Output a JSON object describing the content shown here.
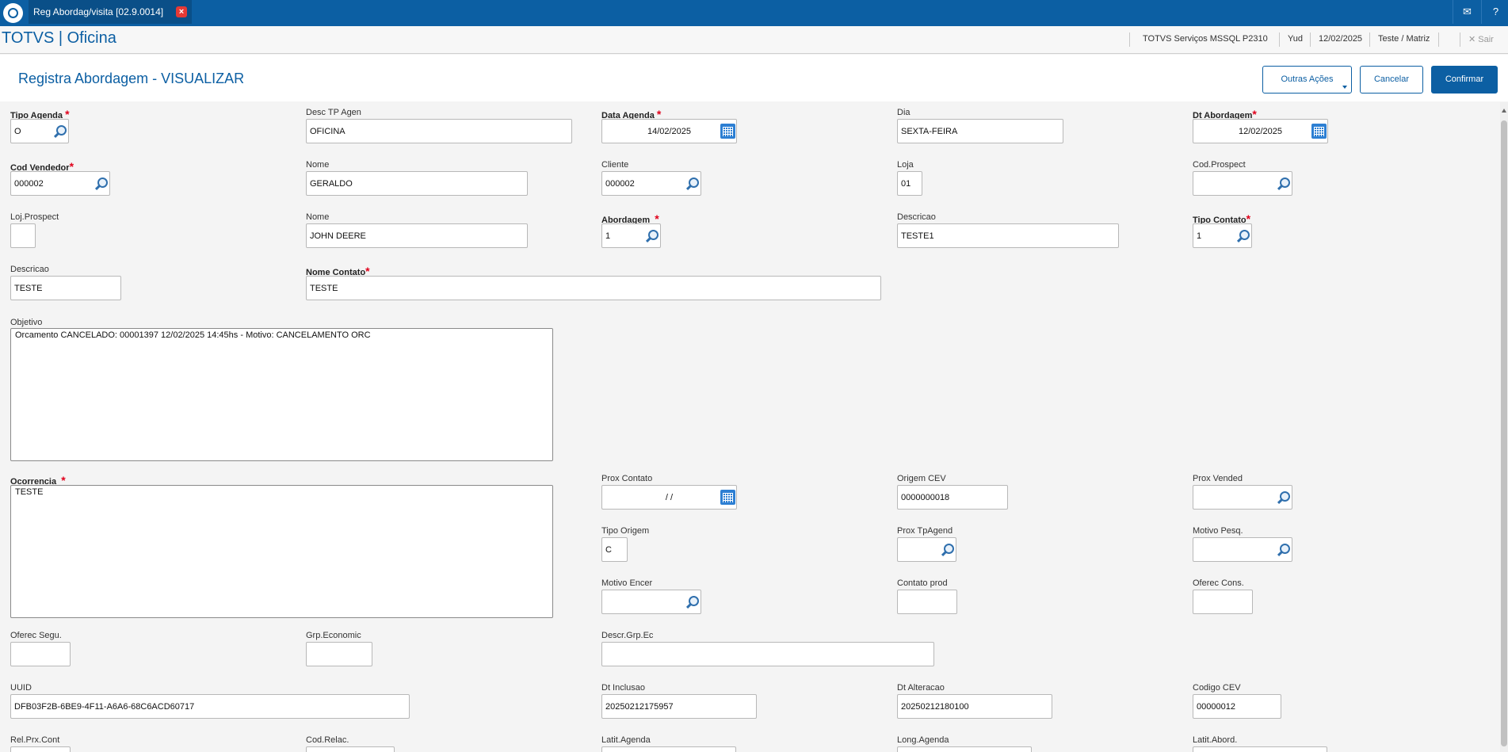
{
  "tab": {
    "title": "Reg Abordag/visita [02.9.0014]"
  },
  "header": {
    "brand": "TOTVS | Oficina",
    "environment": "TOTVS Serviços MSSQL P2310",
    "user": "Yud",
    "date": "12/02/2025",
    "company": "Teste / Matriz",
    "logout": "Sair"
  },
  "page": {
    "title": "Registra Abordagem - VISUALIZAR"
  },
  "actions": {
    "other": "Outras Ações",
    "cancel": "Cancelar",
    "confirm": "Confirmar"
  },
  "fields": {
    "tipo_agenda": {
      "label": "Tipo Agenda",
      "value": "O"
    },
    "desc_tp_agen": {
      "label": "Desc TP Agen",
      "value": "OFICINA"
    },
    "data_agenda": {
      "label": "Data Agenda",
      "value": "14/02/2025"
    },
    "dia": {
      "label": "Dia",
      "value": "SEXTA-FEIRA"
    },
    "dt_abordagem": {
      "label": "Dt Abordagem",
      "value": "12/02/2025"
    },
    "cod_vendedor": {
      "label": "Cod Vendedor",
      "value": "000002"
    },
    "nome_vendedor": {
      "label": "Nome",
      "value": "GERALDO"
    },
    "cliente": {
      "label": "Cliente",
      "value": "000002"
    },
    "loja": {
      "label": "Loja",
      "value": "01"
    },
    "cod_prospect": {
      "label": "Cod.Prospect",
      "value": ""
    },
    "loj_prospect": {
      "label": "Loj.Prospect",
      "value": ""
    },
    "nome_cliente": {
      "label": "Nome",
      "value": "JOHN DEERE"
    },
    "abordagem": {
      "label": "Abordagem",
      "value": "1"
    },
    "descricao_abordagem": {
      "label": "Descricao",
      "value": "TESTE1"
    },
    "tipo_contato": {
      "label": "Tipo Contato",
      "value": "1"
    },
    "descricao_contato": {
      "label": "Descricao",
      "value": "TESTE"
    },
    "nome_contato": {
      "label": "Nome Contato",
      "value": "TESTE"
    },
    "objetivo": {
      "label": "Objetivo",
      "value": "Orcamento CANCELADO: 00001397 12/02/2025 14:45hs - Motivo: CANCELAMENTO ORC"
    },
    "ocorrencia": {
      "label": "Ocorrencia",
      "value": "TESTE"
    },
    "prox_contato": {
      "label": "Prox Contato",
      "value": "/  /"
    },
    "origem_cev": {
      "label": "Origem CEV",
      "value": "0000000018"
    },
    "prox_vended": {
      "label": "Prox Vended",
      "value": ""
    },
    "tipo_origem": {
      "label": "Tipo Origem",
      "value": "C"
    },
    "prox_tpagend": {
      "label": "Prox TpAgend",
      "value": ""
    },
    "motivo_pesq": {
      "label": "Motivo Pesq.",
      "value": ""
    },
    "motivo_encer": {
      "label": "Motivo Encer",
      "value": ""
    },
    "contato_prod": {
      "label": "Contato prod",
      "value": ""
    },
    "oferec_cons": {
      "label": "Oferec Cons.",
      "value": ""
    },
    "oferec_segu": {
      "label": "Oferec Segu.",
      "value": ""
    },
    "grp_economic": {
      "label": "Grp.Economic",
      "value": ""
    },
    "descr_grp_ec": {
      "label": "Descr.Grp.Ec",
      "value": ""
    },
    "uuid": {
      "label": "UUID",
      "value": "DFB03F2B-6BE9-4F11-A6A6-68C6ACD60717"
    },
    "dt_inclusao": {
      "label": "Dt Inclusao",
      "value": "20250212175957"
    },
    "dt_alteracao": {
      "label": "Dt Alteracao",
      "value": "20250212180100"
    },
    "codigo_cev": {
      "label": "Codigo CEV",
      "value": "00000012"
    },
    "rel_prx_cont": {
      "label": "Rel.Prx.Cont",
      "value": ""
    },
    "cod_relac": {
      "label": "Cod.Relac.",
      "value": ""
    },
    "latit_agenda": {
      "label": "Latit.Agenda",
      "value": ""
    },
    "long_agenda": {
      "label": "Long.Agenda",
      "value": ""
    },
    "latit_abord": {
      "label": "Latit.Abord.",
      "value": ""
    }
  },
  "colors": {
    "primary": "#0c5fa3",
    "required": "#e0001b",
    "background": "#f4f4f4"
  },
  "icons": [
    "totvs-logo",
    "close-tab-icon",
    "mail-icon",
    "help-icon",
    "search-icon",
    "calendar-icon"
  ]
}
